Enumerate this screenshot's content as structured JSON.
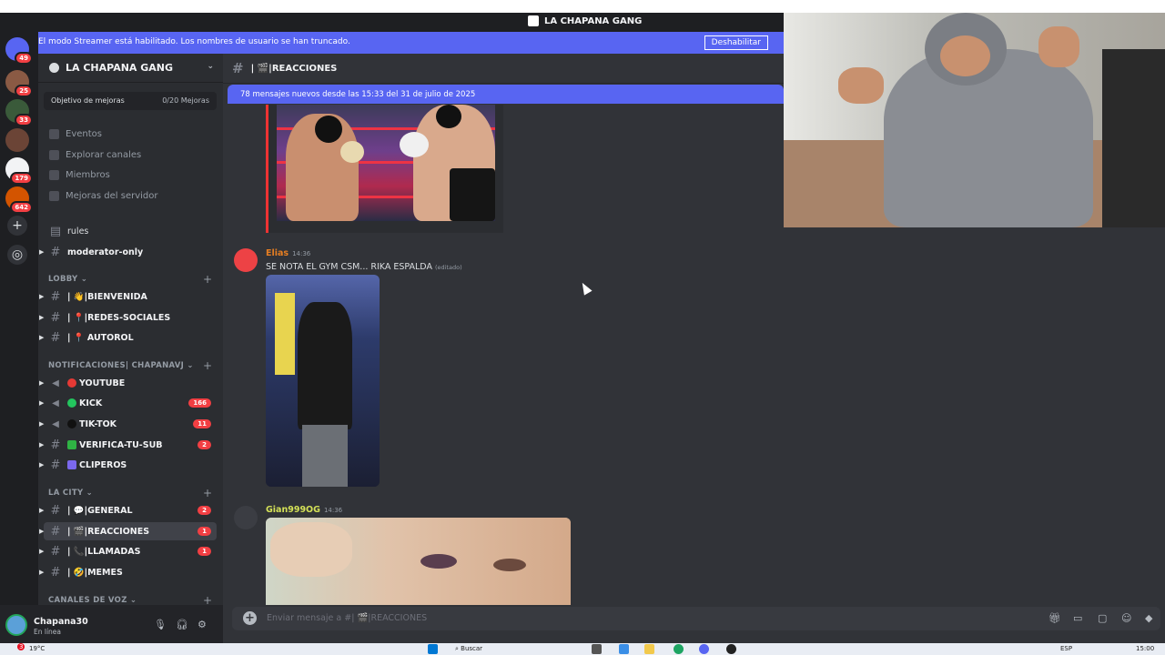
{
  "window": {
    "title": "LA CHAPANA GANG"
  },
  "streamer_banner": {
    "message": "El modo Streamer está habilitado. Los nombres de usuario se han truncado.",
    "button": "Deshabilitar"
  },
  "rail": {
    "badges": [
      "49",
      "25",
      "33",
      "179",
      "642"
    ]
  },
  "server": {
    "name": "LA CHAPANA GANG",
    "boost_goal_label": "Objetivo de mejoras",
    "boost_goal_value": "0/20 Mejoras"
  },
  "nav": [
    {
      "label": "Eventos",
      "icon": "calendar-icon"
    },
    {
      "label": "Explorar canales",
      "icon": "browse-icon"
    },
    {
      "label": "Miembros",
      "icon": "members-icon"
    },
    {
      "label": "Mejoras del servidor",
      "icon": "boost-icon"
    }
  ],
  "top_channels": [
    {
      "name": "rules"
    },
    {
      "name": "moderator-only"
    }
  ],
  "categories": {
    "lobby": "LOBBY",
    "notif": "NOTIFICACIONES| CHAPANAVJ",
    "city": "LA CITY",
    "voice": "CANALES DE VOZ"
  },
  "lobby_channels": [
    {
      "name": "| 👋|BIENVENIDA"
    },
    {
      "name": "| 📍|REDES-SOCIALES"
    },
    {
      "name": "| 📍 AUTOROL"
    }
  ],
  "notif_channels": [
    {
      "name": "YOUTUBE",
      "dot": "#e53935",
      "count": ""
    },
    {
      "name": "KICK",
      "dot": "#23c55e",
      "count": "166"
    },
    {
      "name": "TIK-TOK",
      "dot": "#111111",
      "count": "11"
    },
    {
      "name": "VERIFICA-TU-SUB",
      "dot": "#2fb344",
      "count": "2"
    },
    {
      "name": "CLIPEROS",
      "dot": "#7b68ee",
      "count": ""
    }
  ],
  "city_channels": [
    {
      "name": "| 💬|GENERAL",
      "count": "2"
    },
    {
      "name": "| 🎬|REACCIONES",
      "count": "1"
    },
    {
      "name": "| 📞|LLAMADAS",
      "count": "1"
    },
    {
      "name": "| 🤣|MEMES",
      "count": ""
    }
  ],
  "user": {
    "name": "Chapana30",
    "status": "En línea"
  },
  "chat": {
    "channel": "| 🎬|REACCIONES",
    "new_messages": "78 mensajes nuevos desde las 15:33 del 31 de julio de 2025",
    "messages": [
      {
        "author": "Elias",
        "time": "14:36",
        "text": "SE NOTA EL GYM CSM... RIKA ESPALDA",
        "edited": "(editado)",
        "color": "#e67e22"
      },
      {
        "author": "Gian999OG",
        "time": "14:36",
        "text": "",
        "edited": "",
        "color": "#f1c40f"
      }
    ],
    "composer_placeholder": "Enviar mensaje a #| 🎬|REACCIONES"
  },
  "taskbar": {
    "weather": "19°C",
    "notif_count": "3",
    "search": "Buscar",
    "lang": "ESP",
    "time": "15:00"
  }
}
